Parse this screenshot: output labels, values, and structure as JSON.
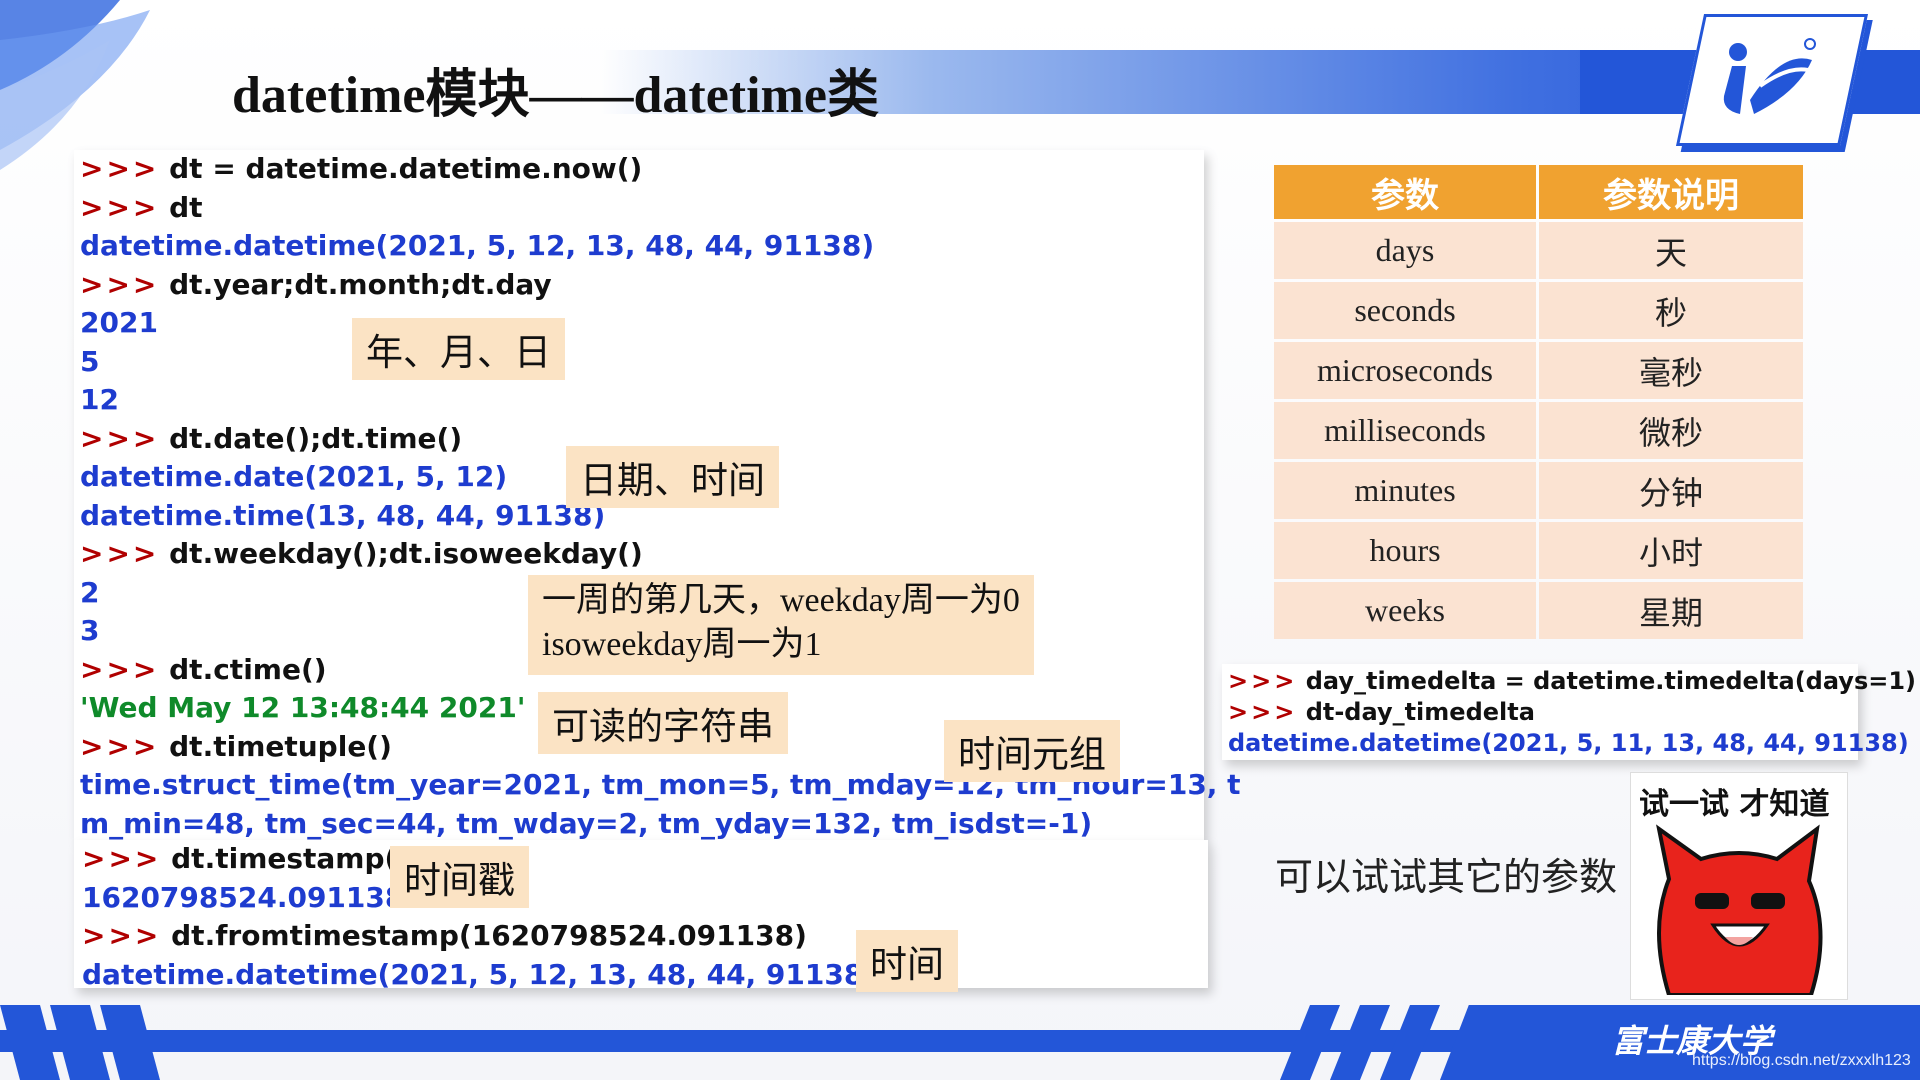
{
  "title": "datetime模块——datetime类",
  "code_lines": [
    {
      "kind": "cmd",
      "prompt": ">>>",
      "text": "dt = datetime.datetime.now()"
    },
    {
      "kind": "cmd",
      "prompt": ">>>",
      "text": "dt"
    },
    {
      "kind": "out",
      "text": "datetime.datetime(2021, 5, 12, 13, 48, 44, 91138)"
    },
    {
      "kind": "cmd",
      "prompt": ">>>",
      "text": "dt.year;dt.month;dt.day"
    },
    {
      "kind": "out",
      "text": "2021"
    },
    {
      "kind": "out",
      "text": "5"
    },
    {
      "kind": "out",
      "text": "12"
    },
    {
      "kind": "cmd",
      "prompt": ">>>",
      "text": "dt.date();dt.time()"
    },
    {
      "kind": "out",
      "text": "datetime.date(2021, 5, 12)"
    },
    {
      "kind": "out",
      "text": "datetime.time(13, 48, 44, 91138)"
    },
    {
      "kind": "cmd",
      "prompt": ">>>",
      "text": "dt.weekday();dt.isoweekday()"
    },
    {
      "kind": "out",
      "text": "2"
    },
    {
      "kind": "out",
      "text": "3"
    },
    {
      "kind": "cmd",
      "prompt": ">>>",
      "text": "dt.ctime()"
    },
    {
      "kind": "str",
      "text": "'Wed May 12 13:48:44 2021'"
    },
    {
      "kind": "cmd",
      "prompt": ">>>",
      "text": "dt.timetuple()"
    },
    {
      "kind": "out",
      "text": "time.struct_time(tm_year=2021, tm_mon=5, tm_mday=12, tm_hour=13, t"
    },
    {
      "kind": "out",
      "text": "m_min=48, tm_sec=44, tm_wday=2, tm_yday=132, tm_isdst=-1)"
    }
  ],
  "code_lines_2": [
    {
      "kind": "cmd",
      "prompt": ">>>",
      "text": "dt.timestamp()"
    },
    {
      "kind": "out",
      "text": "1620798524.091138"
    },
    {
      "kind": "cmd",
      "prompt": ">>>",
      "text": "dt.fromtimestamp(1620798524.091138)"
    },
    {
      "kind": "out",
      "text": "datetime.datetime(2021, 5, 12, 13, 48, 44, 91138)"
    }
  ],
  "notes": {
    "ymd": "年、月、日",
    "date_time": "日期、时间",
    "weekday_line1": "一周的第几天，weekday周一为0",
    "weekday_line2": "isoweekday周一为1",
    "readable": "可读的字符串",
    "tuple": "时间元组",
    "timestamp": "时间戳",
    "time": "时间"
  },
  "table": {
    "headers": [
      "参数",
      "参数说明"
    ],
    "rows": [
      [
        "days",
        "天"
      ],
      [
        "seconds",
        "秒"
      ],
      [
        "microseconds",
        "毫秒"
      ],
      [
        "milliseconds",
        "微秒"
      ],
      [
        "minutes",
        "分钟"
      ],
      [
        "hours",
        "小时"
      ],
      [
        "weeks",
        "星期"
      ]
    ],
    "header_color": "#f0a230",
    "row_color": "#fbe3d2"
  },
  "timedelta_code": [
    {
      "kind": "cmd",
      "prompt": ">>>",
      "text": "day_timedelta = datetime.timedelta(days=1)"
    },
    {
      "kind": "cmd",
      "prompt": ">>>",
      "text": "dt-day_timedelta"
    },
    {
      "kind": "out",
      "text": "datetime.datetime(2021, 5, 11, 13, 48, 44, 91138)"
    }
  ],
  "hint": "可以试试其它的参数",
  "sticker_text": "试一试 才知道",
  "footer": {
    "brand": "富士康大学",
    "url": "https://blog.csdn.net/zxxxlh123"
  },
  "colors": {
    "accent": "#2356d8",
    "prompt": "#b00000",
    "output": "#1e3ccf",
    "note_bg": "#fbe3c4"
  }
}
